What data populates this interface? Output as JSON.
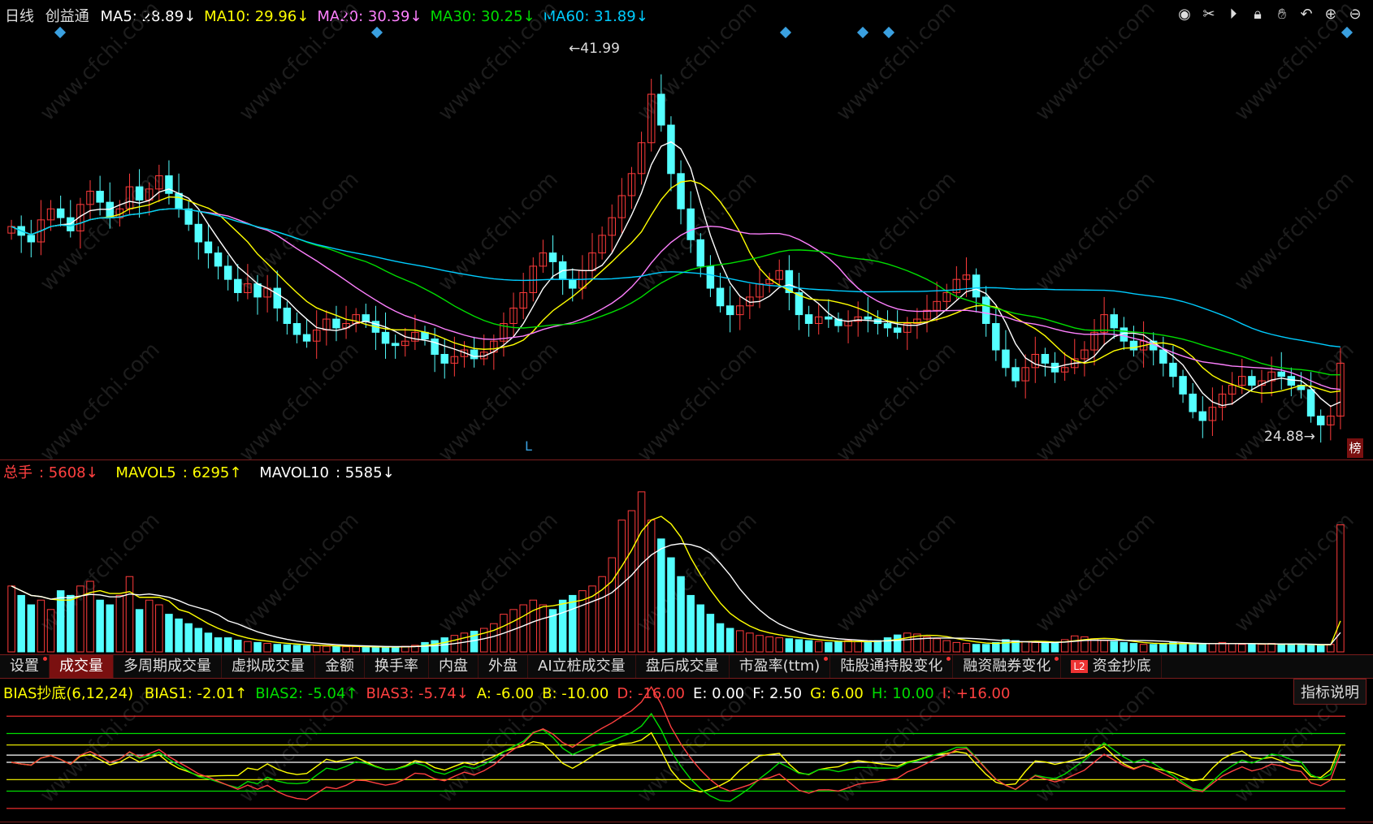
{
  "header": {
    "period": "日线",
    "stock_name": "创益通",
    "ma": [
      {
        "label": "MA5",
        "value": "28.89↓",
        "color": "#ffffff"
      },
      {
        "label": "MA10",
        "value": "29.96↓",
        "color": "#ffff00"
      },
      {
        "label": "MA20",
        "value": "30.39↓",
        "color": "#ff80ff"
      },
      {
        "label": "MA30",
        "value": "30.25↓",
        "color": "#00dd00"
      },
      {
        "label": "MA60",
        "value": "31.89↓",
        "color": "#00ccff"
      }
    ]
  },
  "toolbar_icons": [
    "eye-icon",
    "scissors-icon",
    "play-icon",
    "lock-icon",
    "hand-icon",
    "undo-icon",
    "zoom-in-icon",
    "zoom-out-icon"
  ],
  "price_panel": {
    "high_label": "41.99",
    "low_label": "24.88",
    "l_mark": "L",
    "bang_label": "榜"
  },
  "volume_panel": {
    "total_label": "总手",
    "total_value": "5608↓",
    "mavol5_label": "MAVOL5",
    "mavol5_value": "6295↑",
    "mavol10_label": "MAVOL10",
    "mavol10_value": "5585↓"
  },
  "tabs": [
    {
      "label": "设置",
      "active": false,
      "dot": true
    },
    {
      "label": "成交量",
      "active": true,
      "dot": false
    },
    {
      "label": "多周期成交量",
      "active": false,
      "dot": false
    },
    {
      "label": "虚拟成交量",
      "active": false,
      "dot": false
    },
    {
      "label": "金额",
      "active": false,
      "dot": false
    },
    {
      "label": "换手率",
      "active": false,
      "dot": false
    },
    {
      "label": "内盘",
      "active": false,
      "dot": false
    },
    {
      "label": "外盘",
      "active": false,
      "dot": false
    },
    {
      "label": "AI立桩成交量",
      "active": false,
      "dot": false
    },
    {
      "label": "盘后成交量",
      "active": false,
      "dot": false
    },
    {
      "label": "市盈率(ttm)",
      "active": false,
      "dot": true
    },
    {
      "label": "陆股通持股变化",
      "active": false,
      "dot": true
    },
    {
      "label": "融资融券变化",
      "active": false,
      "dot": true
    },
    {
      "label": "资金抄底",
      "active": false,
      "dot": false,
      "badge": "L2"
    }
  ],
  "indicator": {
    "name": "BIAS抄底(6,12,24)",
    "items": [
      {
        "label": "BIAS1:",
        "value": "-2.01↑",
        "color": "#ffff00"
      },
      {
        "label": "BIAS2:",
        "value": "-5.04↑",
        "color": "#00dd00"
      },
      {
        "label": "BIAS3:",
        "value": "-5.74↓",
        "color": "#ff4040"
      },
      {
        "label": "A:",
        "value": "-6.00",
        "color": "#ffff00"
      },
      {
        "label": "B:",
        "value": "-10.00",
        "color": "#ffff00"
      },
      {
        "label": "D:",
        "value": "-16.00",
        "color": "#ff4040"
      },
      {
        "label": "E:",
        "value": "0.00",
        "color": "#ffffff"
      },
      {
        "label": "F:",
        "value": "2.50",
        "color": "#ffffff"
      },
      {
        "label": "G:",
        "value": "6.00",
        "color": "#ffff00"
      },
      {
        "label": "H:",
        "value": "10.00",
        "color": "#00dd00"
      },
      {
        "label": "I:",
        "value": "+16.00",
        "color": "#ff4040"
      }
    ],
    "help_button": "指标说明"
  },
  "chart_data": {
    "type": "candlestick",
    "price_range": [
      24,
      43
    ],
    "closes": [
      34.2,
      33.8,
      33.5,
      34.5,
      35.0,
      34.6,
      34.0,
      35.2,
      35.8,
      35.3,
      34.6,
      35.0,
      36.0,
      35.4,
      35.9,
      36.5,
      35.7,
      35.0,
      34.3,
      33.5,
      33.0,
      32.4,
      31.8,
      31.2,
      31.6,
      31.0,
      31.4,
      30.5,
      29.8,
      29.3,
      29.0,
      29.5,
      30.0,
      29.6,
      29.8,
      30.2,
      29.9,
      29.4,
      28.9,
      28.8,
      29.0,
      29.4,
      29.1,
      28.4,
      28.0,
      28.3,
      28.6,
      28.2,
      28.5,
      29.0,
      29.8,
      30.5,
      31.2,
      32.4,
      33.0,
      32.6,
      31.8,
      31.4,
      32.2,
      33.0,
      33.8,
      34.6,
      35.6,
      36.6,
      38.0,
      40.2,
      38.8,
      36.6,
      35.0,
      33.6,
      32.4,
      31.4,
      30.6,
      30.2,
      30.6,
      31.0,
      31.6,
      31.8,
      32.2,
      31.2,
      30.2,
      29.8,
      30.1,
      30.0,
      29.7,
      29.9,
      30.1,
      30.0,
      29.8,
      29.6,
      29.4,
      29.8,
      30.0,
      30.4,
      30.8,
      31.2,
      31.8,
      32.0,
      31.0,
      29.8,
      28.6,
      27.8,
      27.2,
      27.8,
      28.4,
      28.0,
      27.6,
      27.8,
      28.2,
      28.6,
      29.4,
      30.2,
      29.6,
      29.0,
      28.6,
      29.0,
      28.6,
      28.0,
      27.4,
      26.6,
      25.8,
      25.4,
      26.0,
      26.6,
      27.0,
      27.4,
      27.0,
      27.2,
      27.6,
      27.4,
      27.0,
      26.8,
      25.6,
      25.2,
      25.6,
      28.0
    ],
    "volumes": [
      14,
      12,
      10,
      11,
      9,
      13,
      12,
      14,
      15,
      11,
      10,
      12,
      16,
      9,
      11,
      10,
      8,
      7,
      6,
      5,
      4,
      3,
      3,
      2.5,
      2.2,
      2,
      1.8,
      1.6,
      1.5,
      1.4,
      1.3,
      1.3,
      1.2,
      1.2,
      1.1,
      1.1,
      1.0,
      1.0,
      1.0,
      1.1,
      1.2,
      1.4,
      2,
      2.4,
      3,
      3.5,
      4,
      4.4,
      5,
      6,
      8,
      9,
      10,
      11,
      10,
      9,
      11,
      12,
      13,
      14,
      16,
      20,
      28,
      30,
      34,
      28,
      24,
      20,
      16,
      12,
      10,
      8,
      6,
      5,
      4.5,
      4,
      3.5,
      3.2,
      3,
      2.8,
      2.6,
      2.4,
      2.2,
      2.0,
      2.2,
      2.4,
      2.2,
      2.0,
      2.4,
      3.0,
      3.6,
      4,
      3.8,
      3.2,
      2.8,
      2.4,
      2.0,
      1.8,
      1.6,
      1.6,
      2,
      2.6,
      2.4,
      2.2,
      2,
      1.8,
      2,
      2.6,
      3.4,
      3.2,
      2.8,
      2.4,
      2.2,
      2,
      1.8,
      1.6,
      1.6,
      1.8,
      2.0,
      1.8,
      1.6,
      1.6,
      1.8,
      2.0,
      1.8,
      1.6,
      1.6,
      1.6,
      1.8,
      1.6,
      1.6,
      1.5,
      1.4,
      1.4,
      1.6,
      27
    ],
    "bias_range": [
      -20,
      20
    ]
  }
}
